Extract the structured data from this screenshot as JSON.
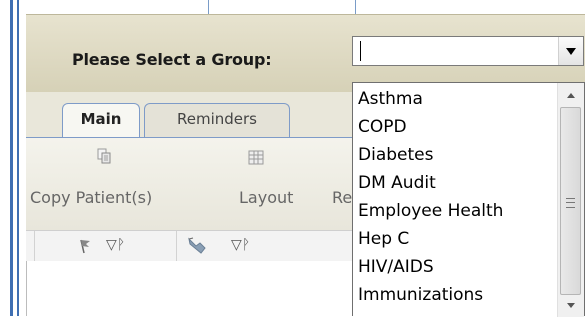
{
  "group_selector": {
    "label": "Please Select a Group:",
    "value": "",
    "options": [
      "Asthma",
      "COPD",
      "Diabetes",
      "DM Audit",
      "Employee Health",
      "Hep C",
      "HIV/AIDS",
      "Immunizations"
    ]
  },
  "tabs": [
    {
      "label": "Main",
      "active": true
    },
    {
      "label": "Reminders",
      "active": false
    }
  ],
  "toolbar": {
    "copy_patients_label": "Copy Patient(s)",
    "layout_label": "Layout",
    "truncated_label": "Re"
  },
  "filter_row": {
    "funnel_pin_1": "▽ᚹ",
    "funnel_pin_2": "▽ᚹ"
  },
  "colors": {
    "frame_blue": "#3f6fb2",
    "tab_border": "#7e9bc8",
    "select_bar": "#ddd8bf"
  }
}
